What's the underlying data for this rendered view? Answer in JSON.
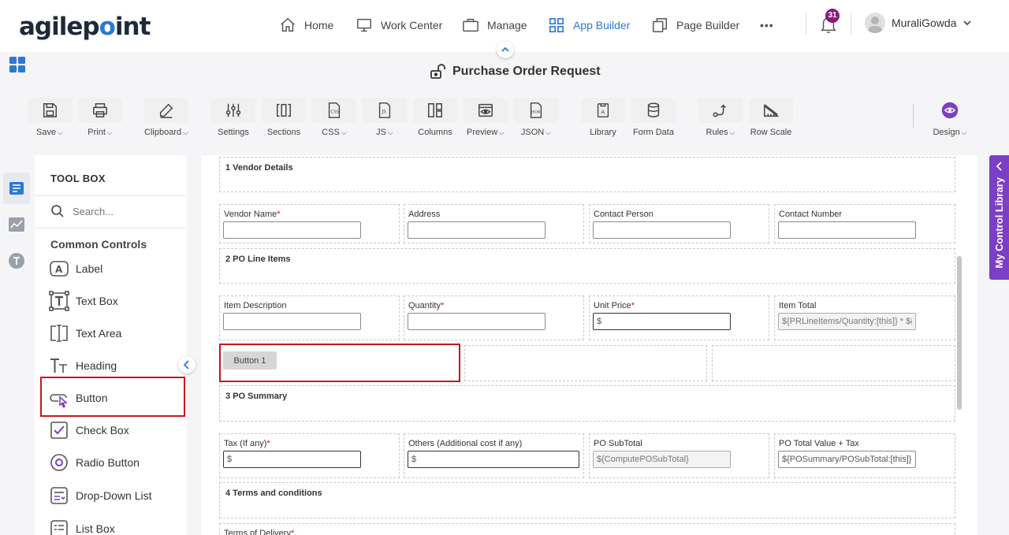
{
  "brand": {
    "logo_pre": "agilep",
    "logo_dot": "o",
    "logo_post": "int"
  },
  "nav": {
    "home": "Home",
    "work_center": "Work Center",
    "manage": "Manage",
    "app_builder": "App Builder",
    "page_builder": "Page Builder",
    "more": "•••",
    "notifications": "31",
    "user": "MuraliGowda",
    "accent": "#2b78d6"
  },
  "page_title": "Purchase Order Request",
  "toolbar": {
    "save": "Save",
    "print": "Print",
    "clipboard": "Clipboard",
    "settings": "Settings",
    "sections": "Sections",
    "css": "CSS",
    "js": "JS",
    "columns": "Columns",
    "preview": "Preview",
    "json": "JSON",
    "library": "Library",
    "form_data": "Form Data",
    "rules": "Rules",
    "row_scale": "Row Scale",
    "design": "Design",
    "caret": "⌵"
  },
  "toolbox": {
    "title": "TOOL BOX",
    "search_placeholder": "Search...",
    "section": "Common Controls",
    "items": [
      "Label",
      "Text Box",
      "Text Area",
      "Heading",
      "Button",
      "Check Box",
      "Radio Button",
      "Drop-Down List",
      "List Box"
    ]
  },
  "form": {
    "sections": {
      "vendor": "1 Vendor Details",
      "po_line": "2 PO Line Items",
      "po_summary": "3 PO Summary",
      "terms": "4 Terms and conditions"
    },
    "vendor_fields": {
      "vendor_name": "Vendor Name",
      "address": "Address",
      "contact_person": "Contact Person",
      "contact_number": "Contact Number"
    },
    "line_fields": {
      "item_description": "Item Description",
      "quantity": "Quantity",
      "unit_price": "Unit Price",
      "unit_price_value": "$",
      "item_total": "Item Total",
      "item_total_value": "${PRLineItems/Quantity:[this]} * ${P"
    },
    "button_label": "Button 1",
    "summary_fields": {
      "tax": "Tax (If any)",
      "tax_value": "$",
      "others": "Others (Additional cost if any)",
      "others_value": "$",
      "subtotal": "PO SubTotal",
      "subtotal_value": "${ComputePOSubTotal}",
      "total": "PO Total Value + Tax",
      "total_value": "${POSummary/POSubTotal:[this]} +${"
    },
    "terms_fields": {
      "terms_delivery": "Terms of Delivery"
    },
    "required_mark": "*"
  },
  "right_panel": {
    "label": "My Control Library",
    "color": "#7b3fc6"
  }
}
